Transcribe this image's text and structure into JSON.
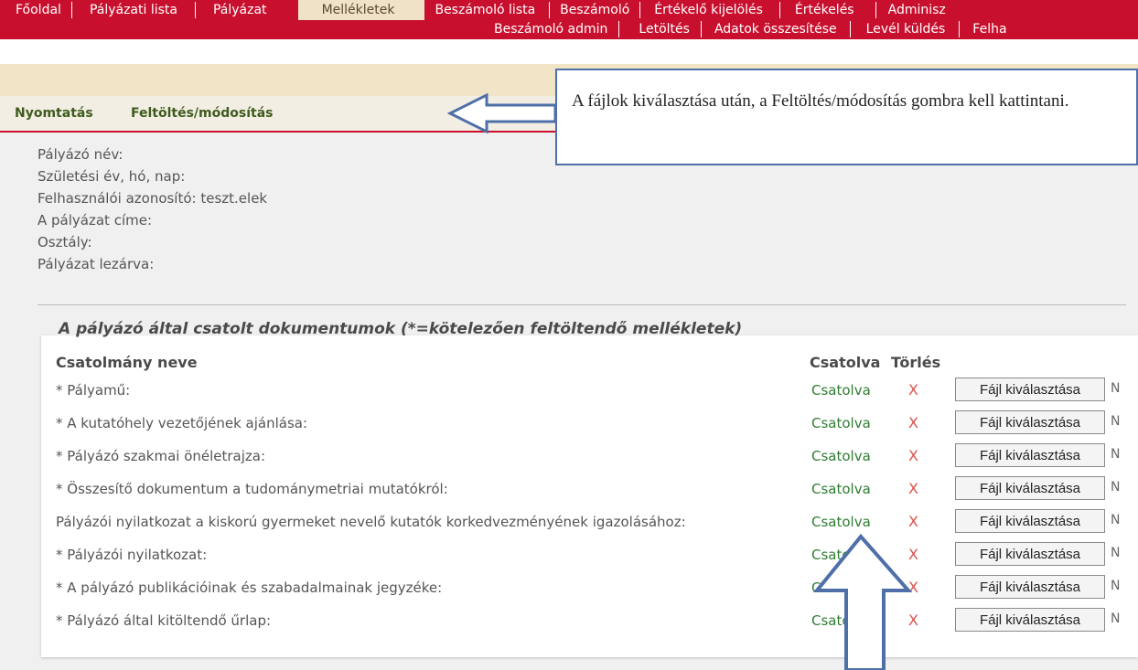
{
  "nav": {
    "row1": [
      "Főoldal",
      "Pályázati lista",
      "Pályázat",
      "Mellékletek",
      "Beszámoló lista",
      "Beszámoló",
      "Értékelő kijelölés",
      "Értékelés",
      "Adminisz"
    ],
    "row2": [
      "Beszámoló admin",
      "Letöltés",
      "Adatok összesítése",
      "Levél küldés",
      "Felha"
    ],
    "active": "Mellékletek"
  },
  "actions": {
    "print": "Nyomtatás",
    "upload": "Feltöltés/módosítás"
  },
  "info": [
    "Pályázó név:",
    "Születési év, hó, nap:",
    "Felhasználói azonosító: teszt.elek",
    "A pályázat címe:",
    "Osztály:",
    "Pályázat lezárva:"
  ],
  "documents": {
    "title": "A pályázó által csatolt dokumentumok (*=kötelezően feltöltendő mellékletek)",
    "headers": {
      "name": "Csatolmány neve",
      "attached": "Csatolva",
      "delete": "Törlés"
    },
    "rows": [
      {
        "label": "* Pályamű:",
        "status": "Csatolva",
        "delete": "X",
        "button": "Fájl kiválasztása",
        "filename": "N"
      },
      {
        "label": "* A kutatóhely vezetőjének ajánlása:",
        "status": "Csatolva",
        "delete": "X",
        "button": "Fájl kiválasztása",
        "filename": "N"
      },
      {
        "label": "* Pályázó szakmai önéletrajza:",
        "status": "Csatolva",
        "delete": "X",
        "button": "Fájl kiválasztása",
        "filename": "N"
      },
      {
        "label": "* Összesítő dokumentum a tudománymetriai mutatókról:",
        "status": "Csatolva",
        "delete": "X",
        "button": "Fájl kiválasztása",
        "filename": "N"
      },
      {
        "label": "Pályázói nyilatkozat a kiskorú gyermeket nevelő kutatók korkedvezményének igazolásához:",
        "status": "Csatolva",
        "delete": "X",
        "button": "Fájl kiválasztása",
        "filename": "N"
      },
      {
        "label": "* Pályázói nyilatkozat:",
        "status": "Csatolva",
        "delete": "X",
        "button": "Fájl kiválasztása",
        "filename": "N"
      },
      {
        "label": "* A pályázó publikációinak és szabadalmainak jegyzéke:",
        "status": "Csatolva",
        "delete": "X",
        "button": "Fájl kiválasztása",
        "filename": "N"
      },
      {
        "label": "* Pályázó által kitöltendő űrlap:",
        "status": "Csatolva",
        "delete": "X",
        "button": "Fájl kiválasztása",
        "filename": "N"
      }
    ]
  },
  "callout": {
    "text": "A fájlok kiválasztása után, a Feltöltés/módosítás gombra kell kattintani."
  },
  "colors": {
    "nav_red": "#c8102e",
    "tan": "#f1e4c7",
    "annotation_blue": "#4f6fa8",
    "status_green": "#2e7d32",
    "delete_red": "#d9534f"
  }
}
